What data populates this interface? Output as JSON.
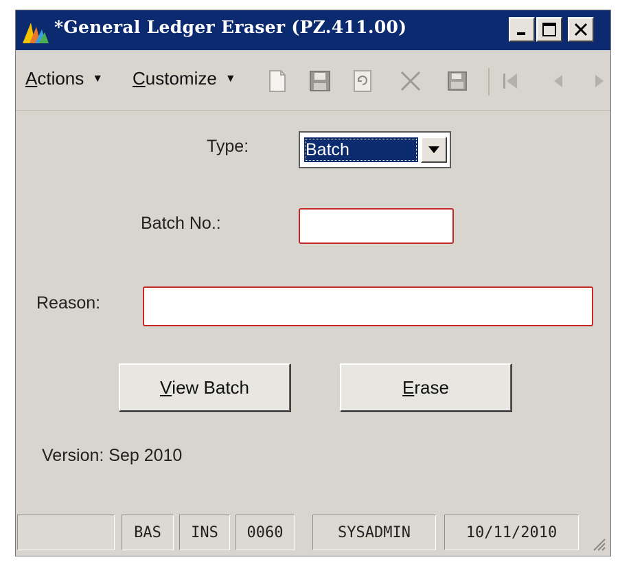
{
  "window": {
    "title": "*General Ledger Eraser (PZ.411.00)",
    "title_bg": "#0b2a6f",
    "icon": "app-chart-icon"
  },
  "menu": {
    "actions": {
      "underline": "A",
      "rest": "ctions"
    },
    "customize": {
      "underline": "C",
      "rest": "ustomize"
    }
  },
  "toolbar_icons": [
    "new-document-icon",
    "save-icon",
    "refresh-icon",
    "delete-icon",
    "save-and-close-icon",
    "first-record-icon",
    "previous-record-icon",
    "next-record-icon"
  ],
  "form": {
    "type_label": "Type:",
    "type_value": "Batch",
    "batch_label": "Batch No.:",
    "batch_value": "",
    "reason_label": "Reason:",
    "reason_value": "",
    "required_color": "#c62828"
  },
  "buttons": {
    "view_batch": {
      "underline": "V",
      "rest": "iew Batch"
    },
    "erase": {
      "underline": "E",
      "rest": "rase"
    }
  },
  "version_text": "Version: Sep 2010",
  "status": {
    "cells": [
      "",
      "BAS",
      "INS",
      "0060",
      "SYSADMIN",
      "10/11/2010"
    ]
  }
}
